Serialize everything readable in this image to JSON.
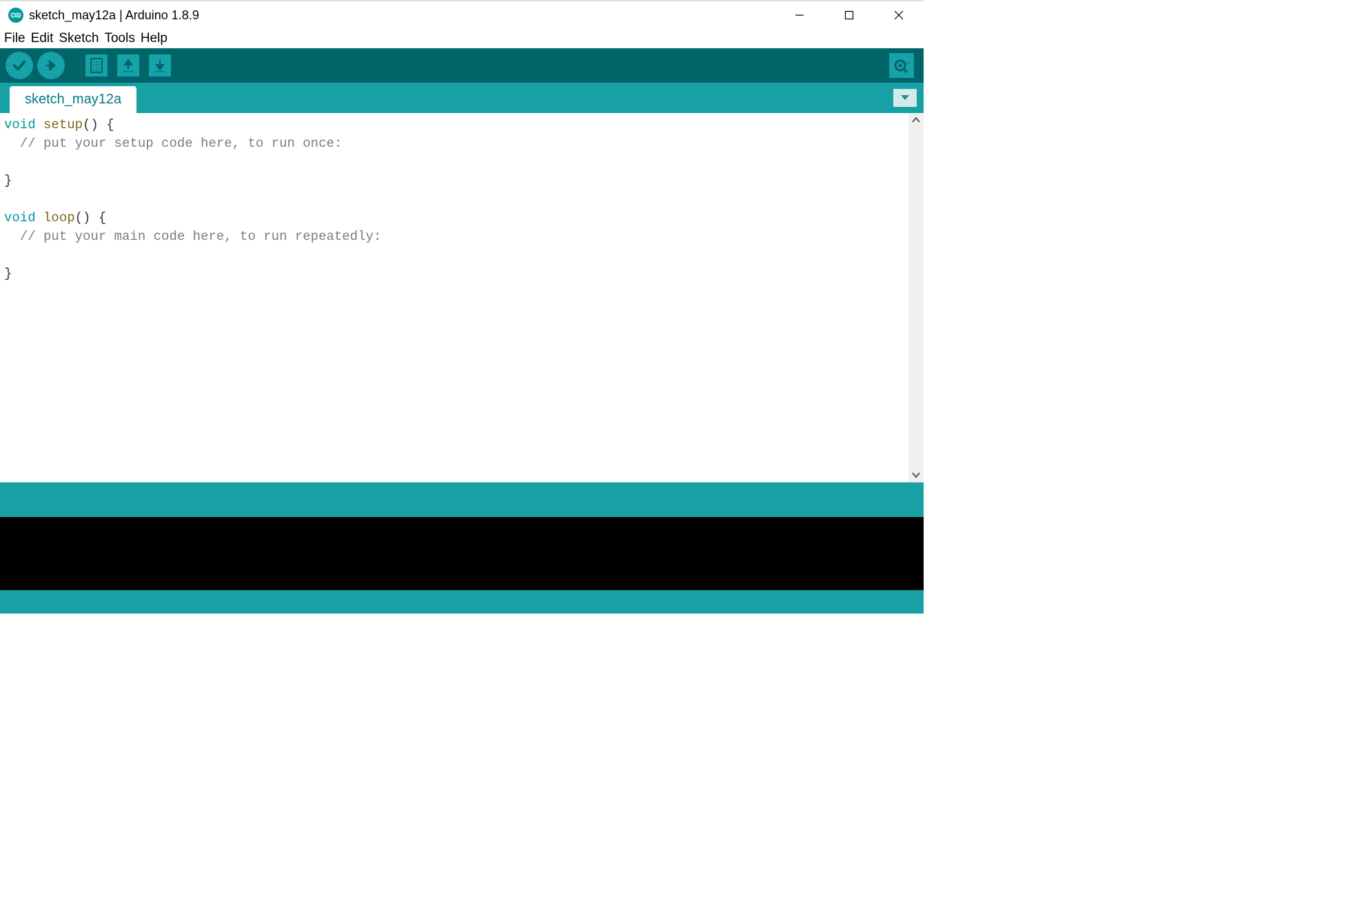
{
  "window": {
    "title": "sketch_may12a | Arduino 1.8.9"
  },
  "menu": {
    "file": "File",
    "edit": "Edit",
    "sketch": "Sketch",
    "tools": "Tools",
    "help": "Help"
  },
  "tabs": {
    "active": "sketch_may12a"
  },
  "code": {
    "lines": [
      {
        "type": "code",
        "kw": "void",
        "fn": "setup",
        "rest": "() {"
      },
      {
        "type": "comment",
        "text": "  // put your setup code here, to run once:"
      },
      {
        "type": "blank",
        "text": ""
      },
      {
        "type": "plain",
        "text": "}"
      },
      {
        "type": "blank",
        "text": ""
      },
      {
        "type": "code",
        "kw": "void",
        "fn": "loop",
        "rest": "() {"
      },
      {
        "type": "comment",
        "text": "  // put your main code here, to run repeatedly:"
      },
      {
        "type": "blank",
        "text": ""
      },
      {
        "type": "plain",
        "text": "}"
      }
    ]
  },
  "icons": {
    "verify": "verify-icon",
    "upload": "upload-icon",
    "new": "new-icon",
    "open": "open-icon",
    "save": "save-icon",
    "serial": "serial-monitor-icon"
  }
}
